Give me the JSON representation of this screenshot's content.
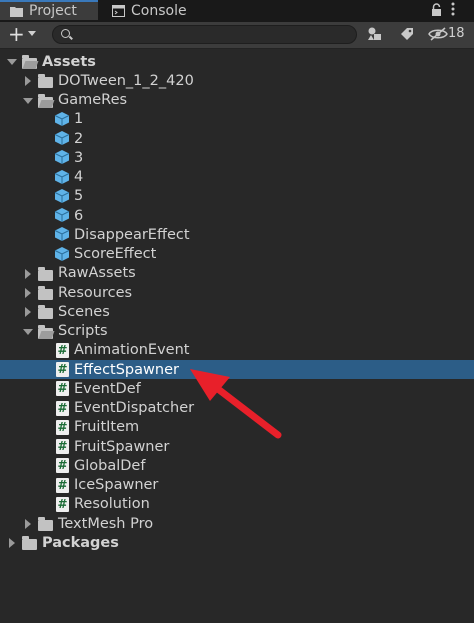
{
  "tabs": [
    {
      "label": "Project",
      "icon": "folder-icon",
      "active": true
    },
    {
      "label": "Console",
      "icon": "console-icon",
      "active": false
    }
  ],
  "toolbar": {
    "add_label": "+",
    "search_placeholder": "",
    "hidden_packages_count": "18"
  },
  "tree": [
    {
      "label": "Assets",
      "type": "folder",
      "expanded": true,
      "depth": 0,
      "bold": true
    },
    {
      "label": "DOTween_1_2_420",
      "type": "folder",
      "expanded": false,
      "depth": 1
    },
    {
      "label": "GameRes",
      "type": "folder",
      "expanded": true,
      "depth": 1
    },
    {
      "label": "1",
      "type": "prefab",
      "depth": 2
    },
    {
      "label": "2",
      "type": "prefab",
      "depth": 2
    },
    {
      "label": "3",
      "type": "prefab",
      "depth": 2
    },
    {
      "label": "4",
      "type": "prefab",
      "depth": 2
    },
    {
      "label": "5",
      "type": "prefab",
      "depth": 2
    },
    {
      "label": "6",
      "type": "prefab",
      "depth": 2
    },
    {
      "label": "DisappearEffect",
      "type": "prefab",
      "depth": 2
    },
    {
      "label": "ScoreEffect",
      "type": "prefab",
      "depth": 2
    },
    {
      "label": "RawAssets",
      "type": "folder",
      "expanded": false,
      "depth": 1
    },
    {
      "label": "Resources",
      "type": "folder",
      "expanded": false,
      "depth": 1
    },
    {
      "label": "Scenes",
      "type": "folder",
      "expanded": false,
      "depth": 1
    },
    {
      "label": "Scripts",
      "type": "folder",
      "expanded": true,
      "depth": 1
    },
    {
      "label": "AnimationEvent",
      "type": "script",
      "depth": 2
    },
    {
      "label": "EffectSpawner",
      "type": "script",
      "depth": 2,
      "selected": true
    },
    {
      "label": "EventDef",
      "type": "script",
      "depth": 2
    },
    {
      "label": "EventDispatcher",
      "type": "script",
      "depth": 2
    },
    {
      "label": "FruitItem",
      "type": "script",
      "depth": 2
    },
    {
      "label": "FruitSpawner",
      "type": "script",
      "depth": 2
    },
    {
      "label": "GlobalDef",
      "type": "script",
      "depth": 2
    },
    {
      "label": "IceSpawner",
      "type": "script",
      "depth": 2
    },
    {
      "label": "Resolution",
      "type": "script",
      "depth": 2
    },
    {
      "label": "TextMesh Pro",
      "type": "folder",
      "expanded": false,
      "depth": 1
    },
    {
      "label": "Packages",
      "type": "folder",
      "expanded": false,
      "depth": 0,
      "bold": true
    }
  ],
  "script_glyph": "#",
  "colors": {
    "selection": "#2c5d87",
    "prefab": "#5fb3e8",
    "annotation_arrow": "#e8202a"
  }
}
